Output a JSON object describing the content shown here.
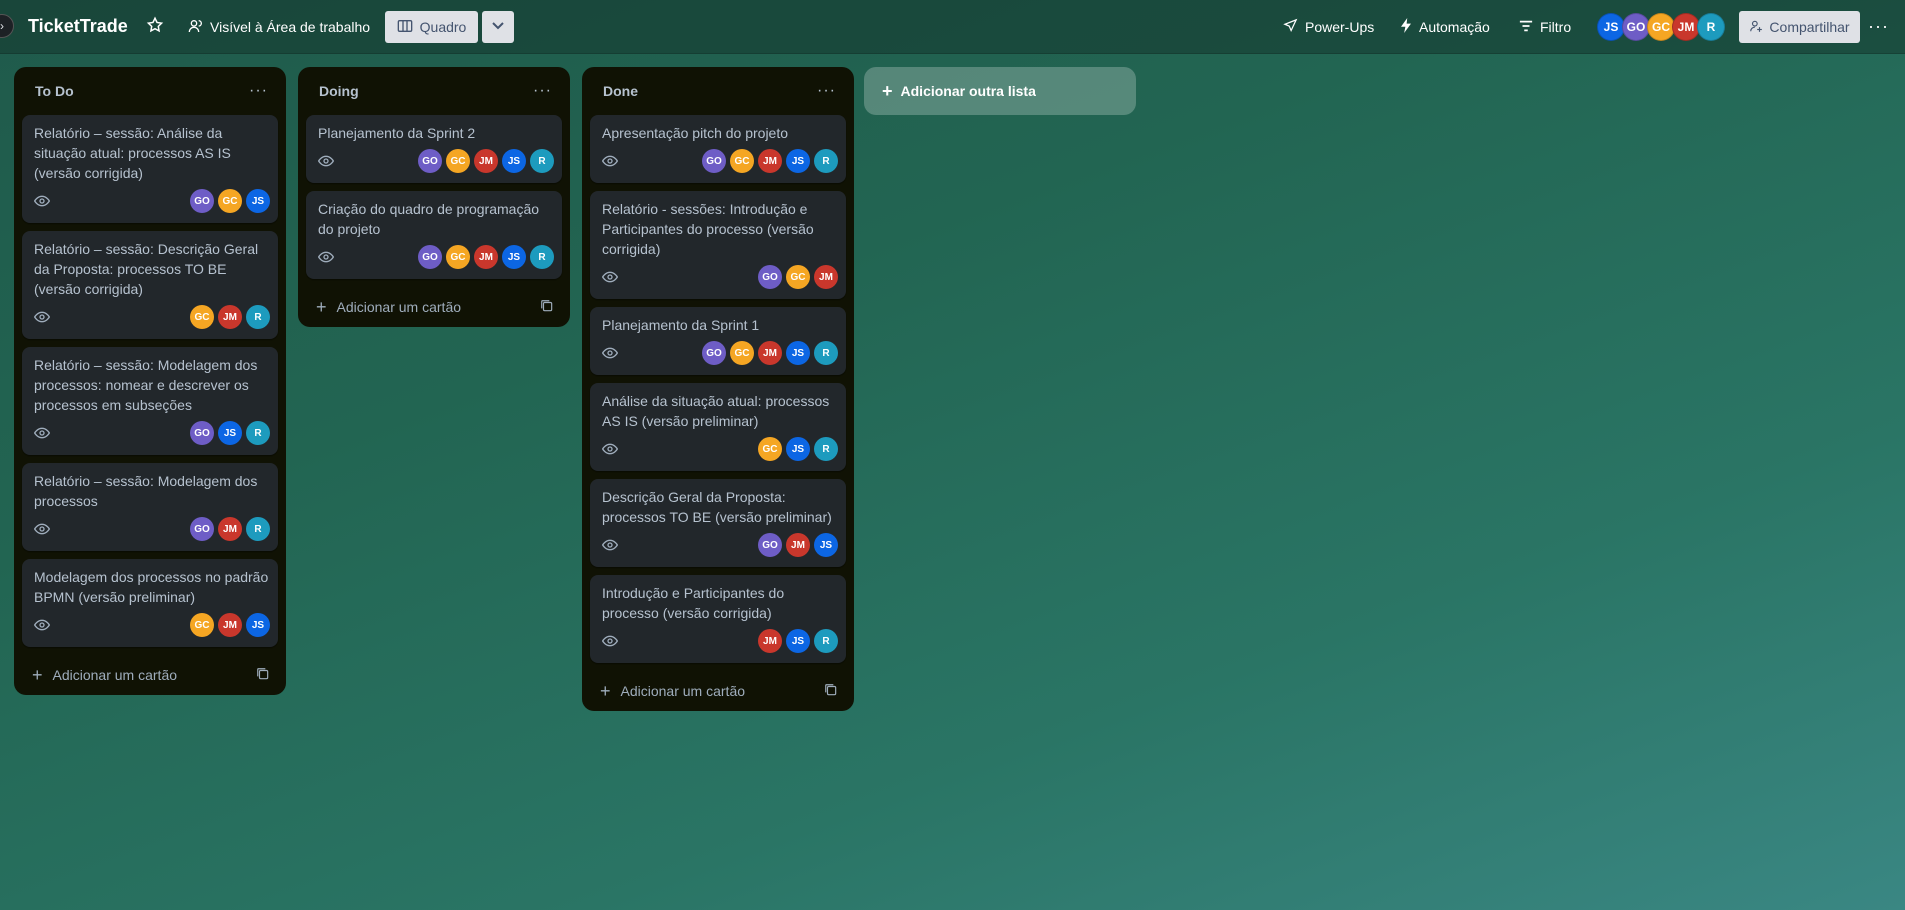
{
  "header": {
    "board_title": "TicketTrade",
    "visibility_label": "Visível à Área de trabalho",
    "view_label": "Quadro",
    "powerups_label": "Power-Ups",
    "automation_label": "Automação",
    "filter_label": "Filtro",
    "share_label": "Compartilhar",
    "members": [
      {
        "initials": "JS",
        "color": "#0c66e4"
      },
      {
        "initials": "GO",
        "color": "#6e5dc6"
      },
      {
        "initials": "GC",
        "color": "#f5a623"
      },
      {
        "initials": "JM",
        "color": "#c9372c"
      },
      {
        "initials": "R",
        "color": "#1d9bbe"
      }
    ]
  },
  "avatar_colors": {
    "GO": "#6e5dc6",
    "GC": "#f5a623",
    "JM": "#c9372c",
    "JS": "#0c66e4",
    "R": "#1d9bbe"
  },
  "lists": [
    {
      "title": "To Do",
      "add_card_label": "Adicionar um cartão",
      "cards": [
        {
          "title": "Relatório – sessão: Análise da situação atual: processos AS IS (versão corrigida)",
          "members": [
            "GO",
            "GC",
            "JS"
          ]
        },
        {
          "title": "Relatório – sessão: Descrição Geral da Proposta: processos TO BE (versão corrigida)",
          "members": [
            "GC",
            "JM",
            "R"
          ]
        },
        {
          "title": "Relatório – sessão: Modelagem dos processos: nomear e descrever os processos em subseções",
          "members": [
            "GO",
            "JS",
            "R"
          ]
        },
        {
          "title": "Relatório – sessão: Modelagem dos processos",
          "members": [
            "GO",
            "JM",
            "R"
          ]
        },
        {
          "title": "Modelagem dos processos no padrão BPMN (versão preliminar)",
          "members": [
            "GC",
            "JM",
            "JS"
          ]
        }
      ]
    },
    {
      "title": "Doing",
      "add_card_label": "Adicionar um cartão",
      "cards": [
        {
          "title": "Planejamento da Sprint 2",
          "members": [
            "GO",
            "GC",
            "JM",
            "JS",
            "R"
          ]
        },
        {
          "title": "Criação do quadro de programação do projeto",
          "members": [
            "GO",
            "GC",
            "JM",
            "JS",
            "R"
          ]
        }
      ]
    },
    {
      "title": "Done",
      "add_card_label": "Adicionar um cartão",
      "cards": [
        {
          "title": "Apresentação pitch do projeto",
          "members": [
            "GO",
            "GC",
            "JM",
            "JS",
            "R"
          ]
        },
        {
          "title": "Relatório - sessões: Introdução e Participantes do processo (versão corrigida)",
          "members": [
            "GO",
            "GC",
            "JM"
          ]
        },
        {
          "title": "Planejamento da Sprint 1",
          "members": [
            "GO",
            "GC",
            "JM",
            "JS",
            "R"
          ]
        },
        {
          "title": "Análise da situação atual: processos AS IS (versão preliminar)",
          "members": [
            "GC",
            "JS",
            "R"
          ]
        },
        {
          "title": "Descrição Geral da Proposta: processos TO BE (versão preliminar)",
          "members": [
            "GO",
            "JM",
            "JS"
          ]
        },
        {
          "title": "Introdução e Participantes do processo (versão corrigida)",
          "members": [
            "JM",
            "JS",
            "R"
          ]
        }
      ]
    }
  ],
  "add_list_label": "Adicionar outra lista"
}
